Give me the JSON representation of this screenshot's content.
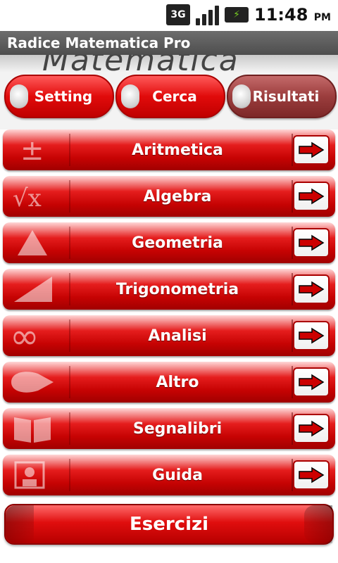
{
  "status": {
    "network": "3G",
    "time": "11:48",
    "ampm": "PM"
  },
  "app": {
    "title": "Radice Matematica Pro",
    "banner": "Matematica"
  },
  "tabs": [
    {
      "label": "Setting"
    },
    {
      "label": "Cerca"
    },
    {
      "label": "Risultati"
    }
  ],
  "menu": [
    {
      "label": "Aritmetica",
      "icon": "plus-minus-icon"
    },
    {
      "label": "Algebra",
      "icon": "square-root-icon"
    },
    {
      "label": "Geometria",
      "icon": "triangle-icon"
    },
    {
      "label": "Trigonometria",
      "icon": "right-triangle-icon"
    },
    {
      "label": "Analisi",
      "icon": "infinity-icon"
    },
    {
      "label": "Altro",
      "icon": "drop-icon"
    },
    {
      "label": "Segnalibri",
      "icon": "book-icon"
    },
    {
      "label": "Guida",
      "icon": "help-icon"
    }
  ],
  "footer_button": {
    "label": "Esercizi"
  }
}
